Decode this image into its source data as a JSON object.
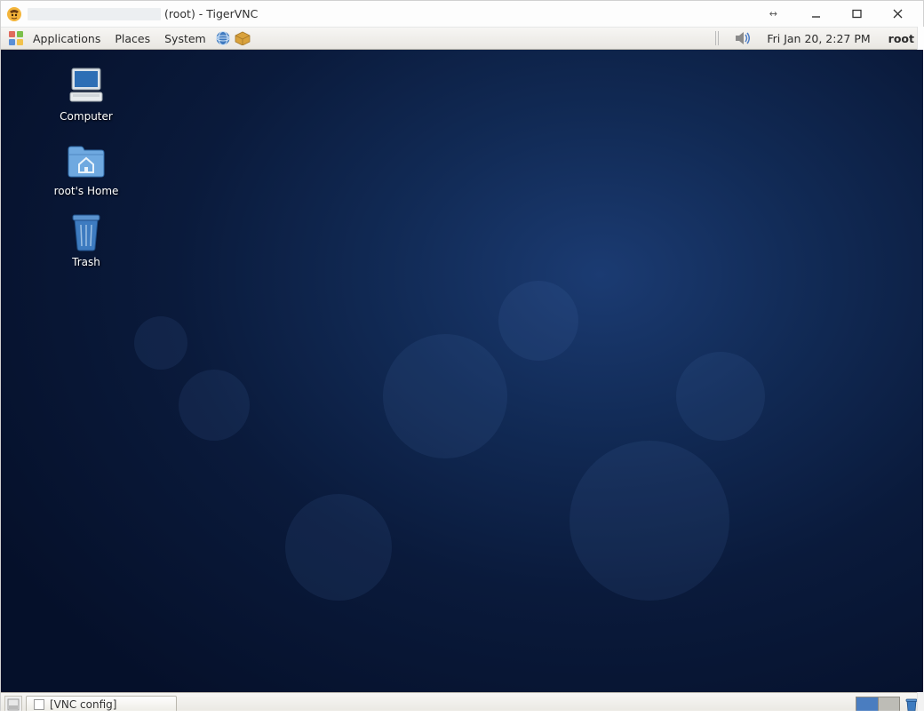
{
  "host_window": {
    "title_suffix": "(root) - TigerVNC"
  },
  "top_panel": {
    "menus": {
      "applications": "Applications",
      "places": "Places",
      "system": "System"
    },
    "clock": "Fri Jan 20,  2:27 PM",
    "user": "root"
  },
  "desktop_icons": {
    "computer": "Computer",
    "home": "root's Home",
    "trash": "Trash"
  },
  "bottom_panel": {
    "task_vnc_config": "[VNC config]"
  }
}
